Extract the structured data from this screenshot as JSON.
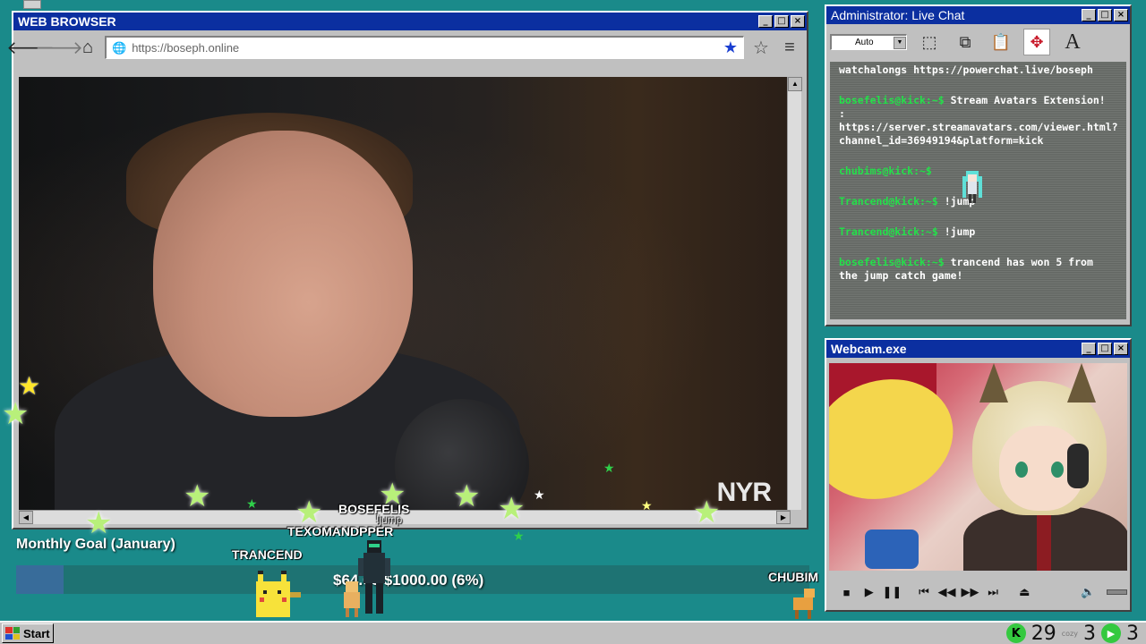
{
  "browser": {
    "title": "WEB BROWSER",
    "url_placeholder": "https://boseph.online",
    "video_logo": "NYR",
    "winbtns": [
      "_",
      "□",
      "×"
    ]
  },
  "chat": {
    "title": "Administrator: Live Chat",
    "dropdown_value": "Auto",
    "messages": [
      {
        "user": "",
        "text": "watchalongs https://powerchat.live/boseph"
      },
      {
        "user": "bosefelis@kick:~$",
        "text": " Stream Avatars Extension! : https://server.streamavatars.com/viewer.html?channel_id=36949194&platform=kick"
      },
      {
        "user": "chubims@kick:~$",
        "text": ""
      },
      {
        "user": "Trancend@kick:~$",
        "text": " !jump"
      },
      {
        "user": "Trancend@kick:~$",
        "text": " !jump"
      },
      {
        "user": "bosefelis@kick:~$",
        "text": " trancend has won 5 from the jump catch game!"
      }
    ]
  },
  "webcam": {
    "title": "Webcam.exe"
  },
  "goal": {
    "title": "Monthly Goal (January)",
    "amount_text": "$64.00/$1000.00 (6%)",
    "progress": 0.06
  },
  "avatars": {
    "bosefelis": "BOSEFELIS",
    "jump": "!jump",
    "texomandpper": "TEXOMANDPPER",
    "trancend": "TRANCEND",
    "chubim": "CHUBIM"
  },
  "taskbar": {
    "start_label": "Start",
    "kick_count": "29",
    "cozy_label": "cozy",
    "cozy_count": "3",
    "play_count": "3"
  },
  "colors": {
    "desktop": "#1a8a8a",
    "titlebar": "#0b2fa0",
    "chat_user": "#24e04a"
  }
}
